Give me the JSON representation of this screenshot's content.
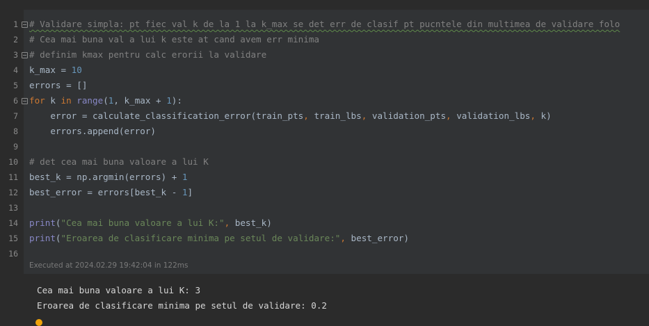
{
  "editor": {
    "line_numbers": [
      "1",
      "2",
      "3",
      "4",
      "5",
      "6",
      "7",
      "8",
      "9",
      "10",
      "11",
      "12",
      "13",
      "14",
      "15",
      "16"
    ],
    "l1": "# Validare simpla: pt fiec val k de la 1 la k_max se det err de clasif pt pucntele din multimea de validare folo",
    "l2": "# Cea mai buna val a lui k este at cand avem err minima",
    "l3": "# definim kmax pentru calc erorii la validare",
    "l4": {
      "a": "k_max = ",
      "b": "10"
    },
    "l5": "errors = []",
    "l6": {
      "kw1": "for",
      "a": " k ",
      "kw2": "in",
      "sp": " ",
      "bi": "range",
      "b": "(",
      "n1": "1",
      "c": ", k_max + ",
      "n2": "1",
      "d": "):"
    },
    "l7": {
      "a": "    error = calculate_classification_error(train_pts",
      "c1": ",",
      "b": " train_lbs",
      "c2": ",",
      "c": " validation_pts",
      "c3": ",",
      "d": " validation_lbs",
      "c4": ",",
      "e": " k)"
    },
    "l8": "    errors.append(error)",
    "l10": "# det cea mai buna valoare a lui K",
    "l11": {
      "a": "best_k = np.argmin(errors) + ",
      "n": "1"
    },
    "l12": {
      "a": "best_error = errors[best_k - ",
      "n": "1",
      "b": "]"
    },
    "l14": {
      "bi": "print",
      "a": "(",
      "s": "\"Cea mai buna valoare a lui K:\"",
      "c": ",",
      "b": " best_k)"
    },
    "l15": {
      "bi": "print",
      "a": "(",
      "s": "\"Eroarea de clasificare minima pe setul de validare:\"",
      "c": ",",
      "b": " best_error)"
    }
  },
  "execution_info": "Executed at 2024.02.29 19:42:04 in 122ms",
  "output": {
    "line1": "Cea mai buna valoare a lui K: 3",
    "line2": "Eroarea de clasificare minima pe setul de validare: 0.2"
  },
  "colors": {
    "comment": "#808080",
    "keyword": "#cc7832",
    "number": "#6897bb",
    "string": "#6a8759",
    "builtin": "#8888c6",
    "status_dot": "#f0a30a"
  }
}
